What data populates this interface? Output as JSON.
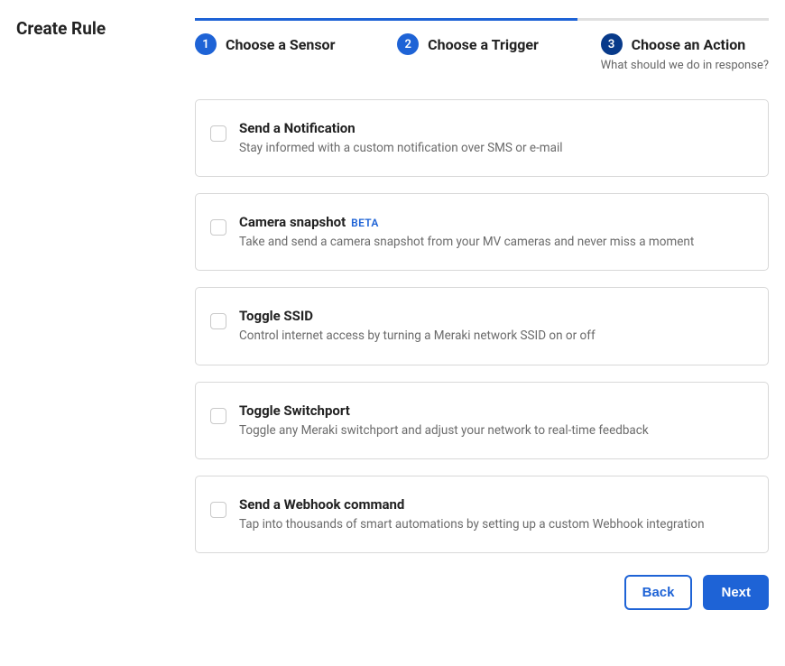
{
  "title": "Create Rule",
  "stepper": {
    "steps": [
      {
        "num": "1",
        "label": "Choose a Sensor",
        "sub": ""
      },
      {
        "num": "2",
        "label": "Choose a Trigger",
        "sub": ""
      },
      {
        "num": "3",
        "label": "Choose an Action",
        "sub": "What should we do in response?"
      }
    ]
  },
  "options": [
    {
      "title": "Send a Notification",
      "badge": "",
      "desc": "Stay informed with a custom notification over SMS or e-mail"
    },
    {
      "title": "Camera snapshot",
      "badge": "BETA",
      "desc": "Take and send a camera snapshot from your MV cameras and never miss a moment"
    },
    {
      "title": "Toggle SSID",
      "badge": "",
      "desc": "Control internet access by turning a Meraki network SSID on or off"
    },
    {
      "title": "Toggle Switchport",
      "badge": "",
      "desc": "Toggle any Meraki switchport and adjust your network to real-time feedback"
    },
    {
      "title": "Send a Webhook command",
      "badge": "",
      "desc": "Tap into thousands of smart automations by setting up a custom Webhook integration"
    }
  ],
  "buttons": {
    "back": "Back",
    "next": "Next"
  }
}
